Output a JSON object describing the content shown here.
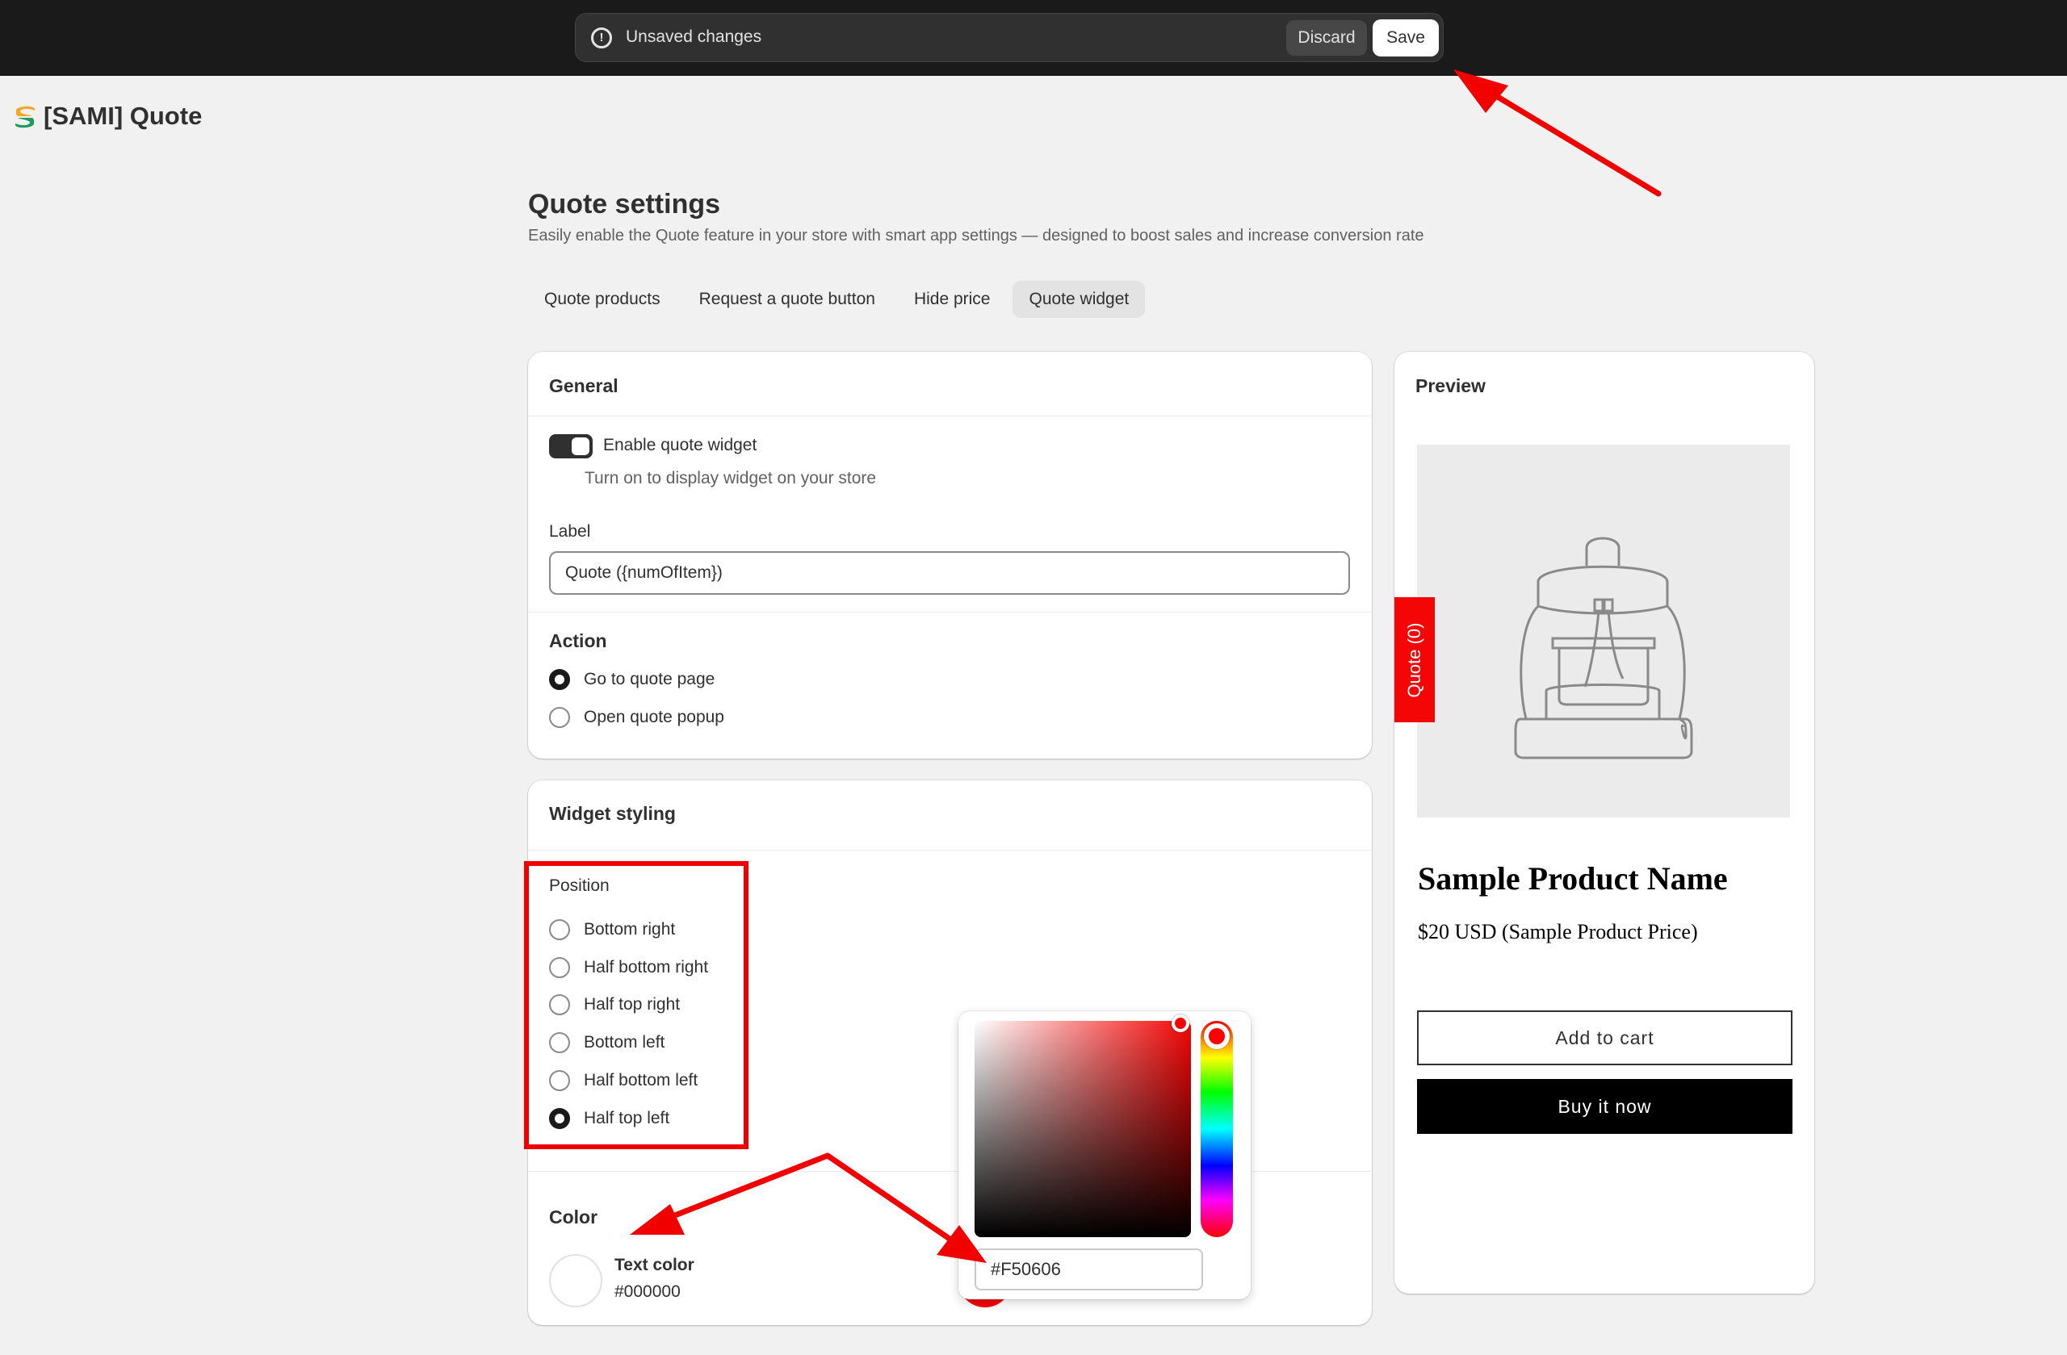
{
  "savebar": {
    "message": "Unsaved changes",
    "discard_label": "Discard",
    "save_label": "Save"
  },
  "app": {
    "title": "[SAMI] Quote",
    "logo_colors": [
      "#f5a623",
      "#1a9c5c"
    ]
  },
  "page": {
    "title": "Quote settings",
    "subtitle": "Easily enable the Quote feature in your store with smart app settings — designed to boost sales and increase conversion rate"
  },
  "tabs": [
    {
      "label": "Quote products",
      "active": false
    },
    {
      "label": "Request a quote button",
      "active": false
    },
    {
      "label": "Hide price",
      "active": false
    },
    {
      "label": "Quote widget",
      "active": true
    }
  ],
  "general": {
    "title": "General",
    "enable_label": "Enable quote widget",
    "enable_help": "Turn on to display widget on your store",
    "enabled": true,
    "label_field_label": "Label",
    "label_field_value": "Quote ({numOfItem})",
    "action_title": "Action",
    "actions": [
      {
        "label": "Go to quote page",
        "checked": true
      },
      {
        "label": "Open quote popup",
        "checked": false
      }
    ]
  },
  "styling": {
    "title": "Widget styling",
    "position_label": "Position",
    "positions": [
      {
        "label": "Bottom right",
        "checked": false
      },
      {
        "label": "Half bottom right",
        "checked": false
      },
      {
        "label": "Half top right",
        "checked": false
      },
      {
        "label": "Bottom left",
        "checked": false
      },
      {
        "label": "Half bottom left",
        "checked": false
      },
      {
        "label": "Half top left",
        "checked": true
      }
    ],
    "color_title": "Color",
    "text_color_label": "Text color",
    "text_color_value": "#000000",
    "picker_value": "#F50606"
  },
  "preview": {
    "title": "Preview",
    "widget_label": "Quote (0)",
    "widget_color": "#f50606",
    "product_name": "Sample Product Name",
    "product_price": "$20 USD (Sample Product Price)",
    "add_to_cart": "Add to cart",
    "buy_now": "Buy it now"
  },
  "annotation_color": "#f20000"
}
